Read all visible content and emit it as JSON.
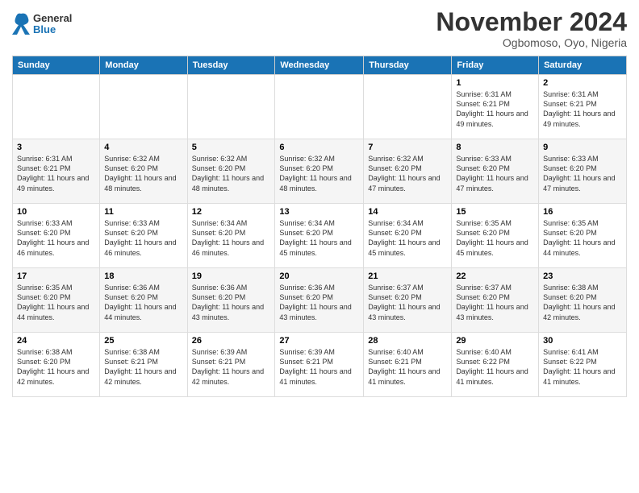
{
  "header": {
    "logo_general": "General",
    "logo_blue": "Blue",
    "month_title": "November 2024",
    "location": "Ogbomoso, Oyo, Nigeria"
  },
  "weekdays": [
    "Sunday",
    "Monday",
    "Tuesday",
    "Wednesday",
    "Thursday",
    "Friday",
    "Saturday"
  ],
  "weeks": [
    [
      {
        "day": "",
        "info": ""
      },
      {
        "day": "",
        "info": ""
      },
      {
        "day": "",
        "info": ""
      },
      {
        "day": "",
        "info": ""
      },
      {
        "day": "",
        "info": ""
      },
      {
        "day": "1",
        "info": "Sunrise: 6:31 AM\nSunset: 6:21 PM\nDaylight: 11 hours and 49 minutes."
      },
      {
        "day": "2",
        "info": "Sunrise: 6:31 AM\nSunset: 6:21 PM\nDaylight: 11 hours and 49 minutes."
      }
    ],
    [
      {
        "day": "3",
        "info": "Sunrise: 6:31 AM\nSunset: 6:21 PM\nDaylight: 11 hours and 49 minutes."
      },
      {
        "day": "4",
        "info": "Sunrise: 6:32 AM\nSunset: 6:20 PM\nDaylight: 11 hours and 48 minutes."
      },
      {
        "day": "5",
        "info": "Sunrise: 6:32 AM\nSunset: 6:20 PM\nDaylight: 11 hours and 48 minutes."
      },
      {
        "day": "6",
        "info": "Sunrise: 6:32 AM\nSunset: 6:20 PM\nDaylight: 11 hours and 48 minutes."
      },
      {
        "day": "7",
        "info": "Sunrise: 6:32 AM\nSunset: 6:20 PM\nDaylight: 11 hours and 47 minutes."
      },
      {
        "day": "8",
        "info": "Sunrise: 6:33 AM\nSunset: 6:20 PM\nDaylight: 11 hours and 47 minutes."
      },
      {
        "day": "9",
        "info": "Sunrise: 6:33 AM\nSunset: 6:20 PM\nDaylight: 11 hours and 47 minutes."
      }
    ],
    [
      {
        "day": "10",
        "info": "Sunrise: 6:33 AM\nSunset: 6:20 PM\nDaylight: 11 hours and 46 minutes."
      },
      {
        "day": "11",
        "info": "Sunrise: 6:33 AM\nSunset: 6:20 PM\nDaylight: 11 hours and 46 minutes."
      },
      {
        "day": "12",
        "info": "Sunrise: 6:34 AM\nSunset: 6:20 PM\nDaylight: 11 hours and 46 minutes."
      },
      {
        "day": "13",
        "info": "Sunrise: 6:34 AM\nSunset: 6:20 PM\nDaylight: 11 hours and 45 minutes."
      },
      {
        "day": "14",
        "info": "Sunrise: 6:34 AM\nSunset: 6:20 PM\nDaylight: 11 hours and 45 minutes."
      },
      {
        "day": "15",
        "info": "Sunrise: 6:35 AM\nSunset: 6:20 PM\nDaylight: 11 hours and 45 minutes."
      },
      {
        "day": "16",
        "info": "Sunrise: 6:35 AM\nSunset: 6:20 PM\nDaylight: 11 hours and 44 minutes."
      }
    ],
    [
      {
        "day": "17",
        "info": "Sunrise: 6:35 AM\nSunset: 6:20 PM\nDaylight: 11 hours and 44 minutes."
      },
      {
        "day": "18",
        "info": "Sunrise: 6:36 AM\nSunset: 6:20 PM\nDaylight: 11 hours and 44 minutes."
      },
      {
        "day": "19",
        "info": "Sunrise: 6:36 AM\nSunset: 6:20 PM\nDaylight: 11 hours and 43 minutes."
      },
      {
        "day": "20",
        "info": "Sunrise: 6:36 AM\nSunset: 6:20 PM\nDaylight: 11 hours and 43 minutes."
      },
      {
        "day": "21",
        "info": "Sunrise: 6:37 AM\nSunset: 6:20 PM\nDaylight: 11 hours and 43 minutes."
      },
      {
        "day": "22",
        "info": "Sunrise: 6:37 AM\nSunset: 6:20 PM\nDaylight: 11 hours and 43 minutes."
      },
      {
        "day": "23",
        "info": "Sunrise: 6:38 AM\nSunset: 6:20 PM\nDaylight: 11 hours and 42 minutes."
      }
    ],
    [
      {
        "day": "24",
        "info": "Sunrise: 6:38 AM\nSunset: 6:20 PM\nDaylight: 11 hours and 42 minutes."
      },
      {
        "day": "25",
        "info": "Sunrise: 6:38 AM\nSunset: 6:21 PM\nDaylight: 11 hours and 42 minutes."
      },
      {
        "day": "26",
        "info": "Sunrise: 6:39 AM\nSunset: 6:21 PM\nDaylight: 11 hours and 42 minutes."
      },
      {
        "day": "27",
        "info": "Sunrise: 6:39 AM\nSunset: 6:21 PM\nDaylight: 11 hours and 41 minutes."
      },
      {
        "day": "28",
        "info": "Sunrise: 6:40 AM\nSunset: 6:21 PM\nDaylight: 11 hours and 41 minutes."
      },
      {
        "day": "29",
        "info": "Sunrise: 6:40 AM\nSunset: 6:22 PM\nDaylight: 11 hours and 41 minutes."
      },
      {
        "day": "30",
        "info": "Sunrise: 6:41 AM\nSunset: 6:22 PM\nDaylight: 11 hours and 41 minutes."
      }
    ]
  ]
}
